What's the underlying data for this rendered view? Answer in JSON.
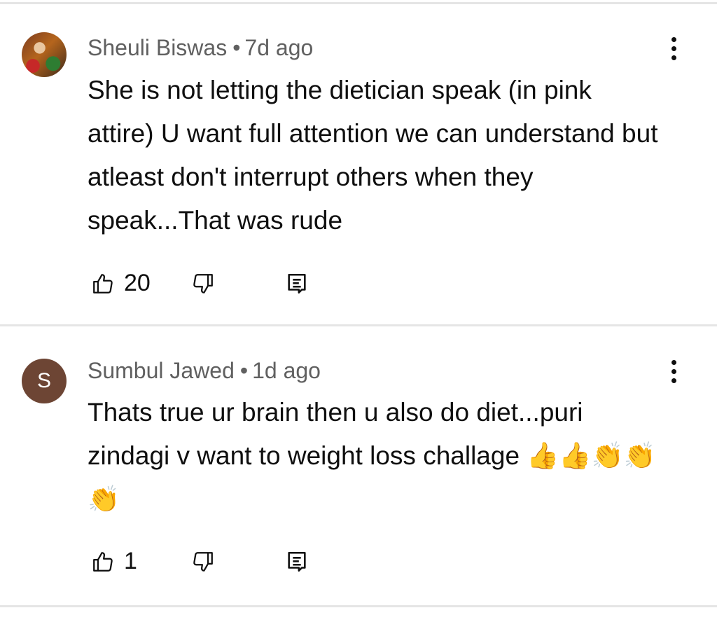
{
  "comments": [
    {
      "author": "Sheuli Biswas",
      "age": "7d ago",
      "avatar": {
        "type": "photo",
        "letter": ""
      },
      "text": "She is not letting the dietician speak (in pink attire) U want full attention we can understand but atleast don't interrupt others when they speak...That was rude",
      "likes": "20"
    },
    {
      "author": "Sumbul Jawed",
      "age": "1d ago",
      "avatar": {
        "type": "letter",
        "letter": "S",
        "color": "#6d4534"
      },
      "text": "Thats true ur brain then u also do diet...puri zindagi v want to weight loss challage 👍👍👏👏👏",
      "likes": "1"
    }
  ],
  "separator": "•",
  "icons": {
    "like": "thumbs-up-icon",
    "dislike": "thumbs-down-icon",
    "reply": "reply-icon",
    "menu": "more-vertical-icon"
  },
  "colors": {
    "meta_text": "#606060",
    "divider": "#e5e5e5",
    "avatar_letter_bg": "#6d4534"
  }
}
